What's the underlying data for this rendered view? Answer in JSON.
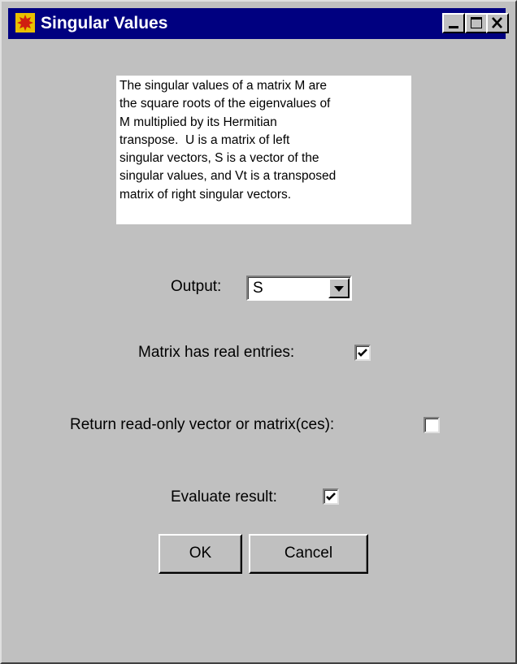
{
  "window": {
    "title": "Singular Values",
    "controls": {
      "minimize": "minimize",
      "maximize": "maximize",
      "close": "close"
    }
  },
  "description": {
    "lines": [
      "The singular values of a matrix M are",
      "the square roots of the eigenvalues of",
      "M multiplied by its Hermitian",
      "transpose.  U is a matrix of left",
      "singular vectors, S is a vector of the",
      "singular values, and Vt is a transposed",
      "matrix of right singular vectors."
    ]
  },
  "output": {
    "label": "Output:",
    "selected": "S"
  },
  "options": {
    "real_entries": {
      "label": "Matrix has real entries:",
      "checked": true
    },
    "read_only": {
      "label": "Return read-only vector or matrix(ces):",
      "checked": false
    },
    "evaluate": {
      "label": "Evaluate result:",
      "checked": true
    }
  },
  "buttons": {
    "ok": "OK",
    "cancel": "Cancel"
  },
  "icons": {
    "app": "maple-leaf-icon",
    "minimize": "minimize-icon",
    "maximize": "maximize-icon",
    "close": "close-icon",
    "dropdown": "chevron-down-icon",
    "check": "checkmark-icon"
  },
  "colors": {
    "titlebar": "#000080",
    "dialog_background": "#c0c0c0",
    "description_background": "#ffffff"
  }
}
